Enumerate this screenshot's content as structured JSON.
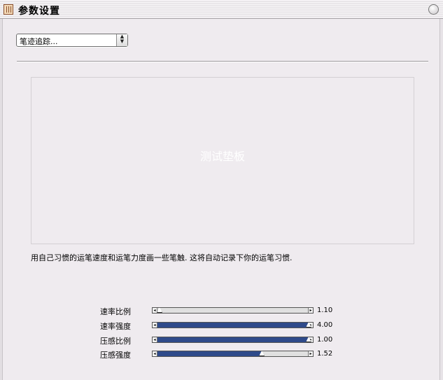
{
  "window": {
    "title": "参数设置"
  },
  "mode_select": {
    "value": "笔迹追踪..."
  },
  "test_pad": {
    "label": "测试垫板"
  },
  "instruction": "用自己习惯的运笔速度和运笔力度画一些笔触. 这将自动记录下你的运笔习惯.",
  "params": [
    {
      "label": "速率比例",
      "value": "1.10",
      "level": 0.02
    },
    {
      "label": "速率强度",
      "value": "4.00",
      "level": 1.0
    },
    {
      "label": "压感比例",
      "value": "1.00",
      "level": 1.0
    },
    {
      "label": "压感强度",
      "value": "1.52",
      "level": 0.68
    }
  ],
  "colors": {
    "slider_fill": "#2f4a8a",
    "background": "#efebef"
  },
  "icons": {
    "app": "app-icon",
    "zoom": "zoom-button-icon",
    "popup": "up-down-arrows-icon"
  }
}
